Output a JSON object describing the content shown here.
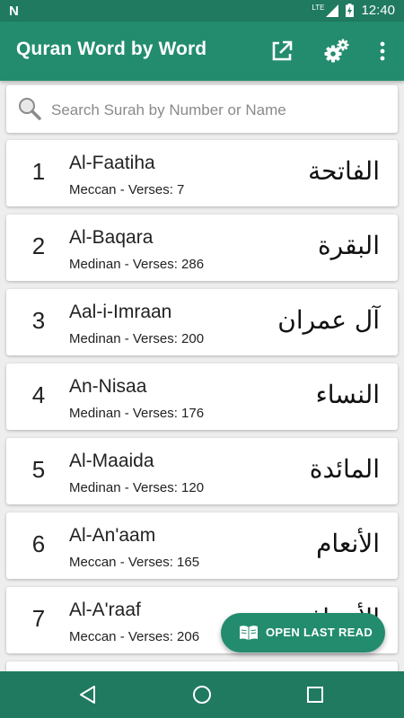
{
  "status_bar": {
    "network": "LTE",
    "time": "12:40"
  },
  "toolbar": {
    "title": "Quran Word by Word"
  },
  "search": {
    "placeholder": "Search Surah by Number or Name",
    "value": ""
  },
  "surahs": [
    {
      "number": "1",
      "name": "Al-Faatiha",
      "meta": "Meccan - Verses: 7",
      "arabic": "الفاتحة"
    },
    {
      "number": "2",
      "name": "Al-Baqara",
      "meta": "Medinan - Verses: 286",
      "arabic": "البقرة"
    },
    {
      "number": "3",
      "name": "Aal-i-Imraan",
      "meta": "Medinan - Verses: 200",
      "arabic": "آل عمران"
    },
    {
      "number": "4",
      "name": "An-Nisaa",
      "meta": "Medinan - Verses: 176",
      "arabic": "النساء"
    },
    {
      "number": "5",
      "name": "Al-Maaida",
      "meta": "Medinan - Verses: 120",
      "arabic": "المائدة"
    },
    {
      "number": "6",
      "name": "Al-An'aam",
      "meta": "Meccan - Verses: 165",
      "arabic": "الأنعام"
    },
    {
      "number": "7",
      "name": "Al-A'raaf",
      "meta": "Meccan - Verses: 206",
      "arabic": "الأعراف"
    }
  ],
  "fab": {
    "label": "OPEN LAST READ"
  },
  "colors": {
    "primary": "#238c6e",
    "primary_dark": "#1f7a60",
    "background": "#eeeeee"
  }
}
